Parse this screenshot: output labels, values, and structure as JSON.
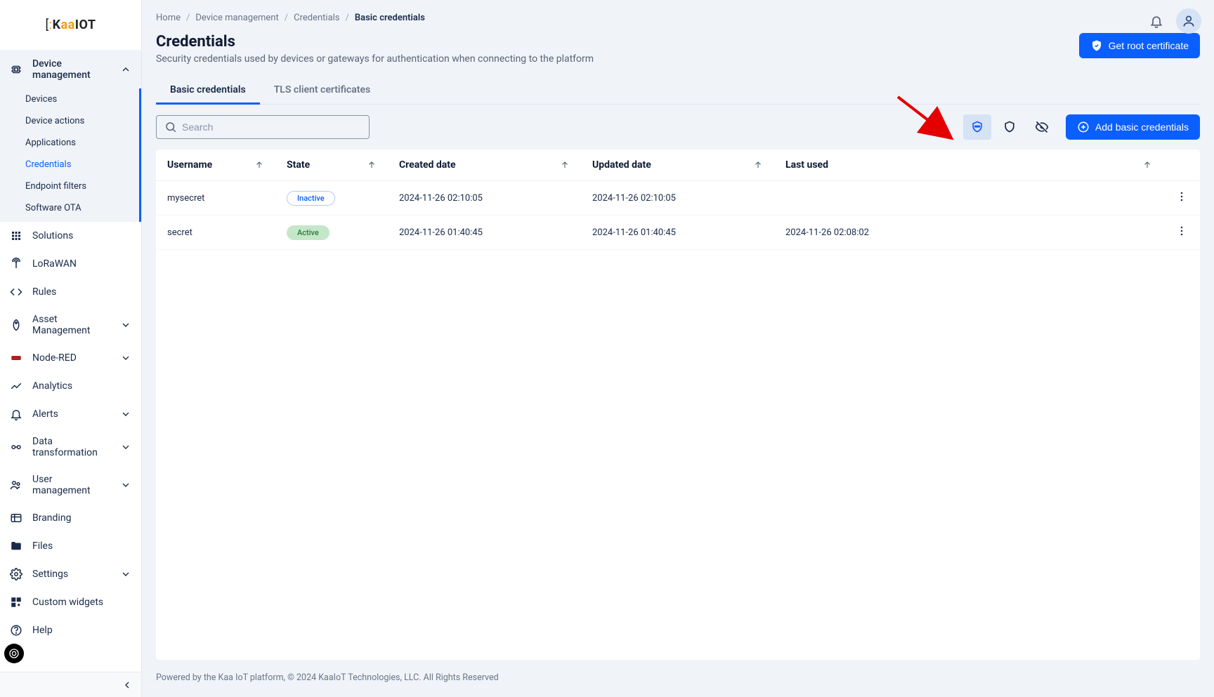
{
  "brand": {
    "part1": "K",
    "part2": "aa",
    "part3": "IOT",
    "bracket_left": "[",
    "bracket_right": ":"
  },
  "sidebar": {
    "device_management": {
      "label": "Device management",
      "items": [
        {
          "label": "Devices"
        },
        {
          "label": "Device actions"
        },
        {
          "label": "Applications"
        },
        {
          "label": "Credentials"
        },
        {
          "label": "Endpoint filters"
        },
        {
          "label": "Software OTA"
        }
      ]
    },
    "items": [
      {
        "label": "Solutions"
      },
      {
        "label": "LoRaWAN"
      },
      {
        "label": "Rules"
      },
      {
        "label": "Asset Management"
      },
      {
        "label": "Node-RED"
      },
      {
        "label": "Analytics"
      },
      {
        "label": "Alerts"
      },
      {
        "label": "Data transformation"
      },
      {
        "label": "User management"
      },
      {
        "label": "Branding"
      },
      {
        "label": "Files"
      },
      {
        "label": "Settings"
      },
      {
        "label": "Custom widgets"
      },
      {
        "label": "Help"
      }
    ]
  },
  "breadcrumb": {
    "items": [
      "Home",
      "Device management",
      "Credentials"
    ],
    "current": "Basic credentials"
  },
  "page": {
    "title": "Credentials",
    "subtitle": "Security credentials used by devices or gateways for authentication when connecting to the platform",
    "root_cert_btn": "Get root certificate"
  },
  "tabs": {
    "basic": "Basic credentials",
    "tls": "TLS client certificates"
  },
  "search": {
    "placeholder": "Search"
  },
  "toolbar": {
    "add_btn": "Add basic credentials"
  },
  "table": {
    "headers": {
      "username": "Username",
      "state": "State",
      "created": "Created date",
      "updated": "Updated date",
      "last_used": "Last used"
    },
    "rows": [
      {
        "username": "mysecret",
        "state": "Inactive",
        "state_class": "inactive",
        "created": "2024-11-26 02:10:05",
        "updated": "2024-11-26 02:10:05",
        "last_used": ""
      },
      {
        "username": "secret",
        "state": "Active",
        "state_class": "active",
        "created": "2024-11-26 01:40:45",
        "updated": "2024-11-26 01:40:45",
        "last_used": "2024-11-26 02:08:02"
      }
    ]
  },
  "footer": "Powered by the Kaa IoT platform, © 2024 KaaIoT Technologies, LLC. All Rights Reserved"
}
